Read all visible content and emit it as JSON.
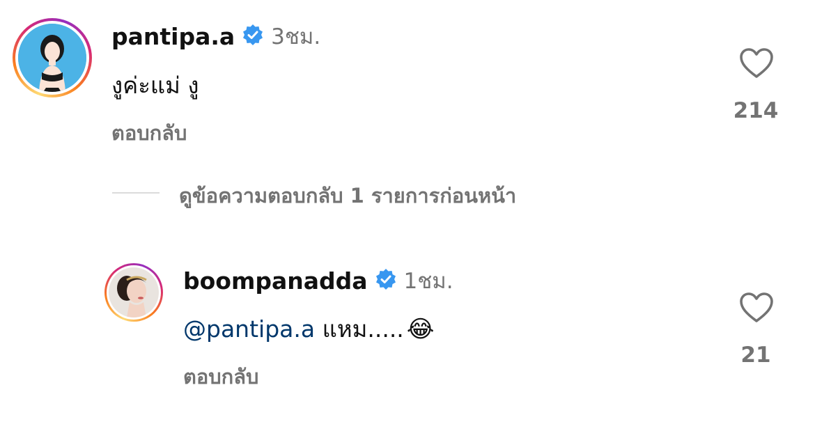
{
  "comments": [
    {
      "username": "pantipa.a",
      "time": "3ชม.",
      "text": "งูค่ะแม่ งู",
      "reply_label": "ตอบกลับ",
      "likes": "214"
    }
  ],
  "view_replies_label": "ดูข้อความตอบกลับ 1 รายการก่อนหน้า",
  "replies": [
    {
      "username": "boompanadda",
      "time": "1ชม.",
      "mention": "@pantipa.a",
      "text": " แหม.....",
      "emoji": "😂",
      "reply_label": "ตอบกลับ",
      "likes": "21"
    }
  ],
  "colors": {
    "verified": "#3897f0",
    "mention": "#00376b",
    "secondary_text": "#737373"
  },
  "icons": {
    "verified": "verified-badge-icon",
    "like": "heart-icon"
  }
}
